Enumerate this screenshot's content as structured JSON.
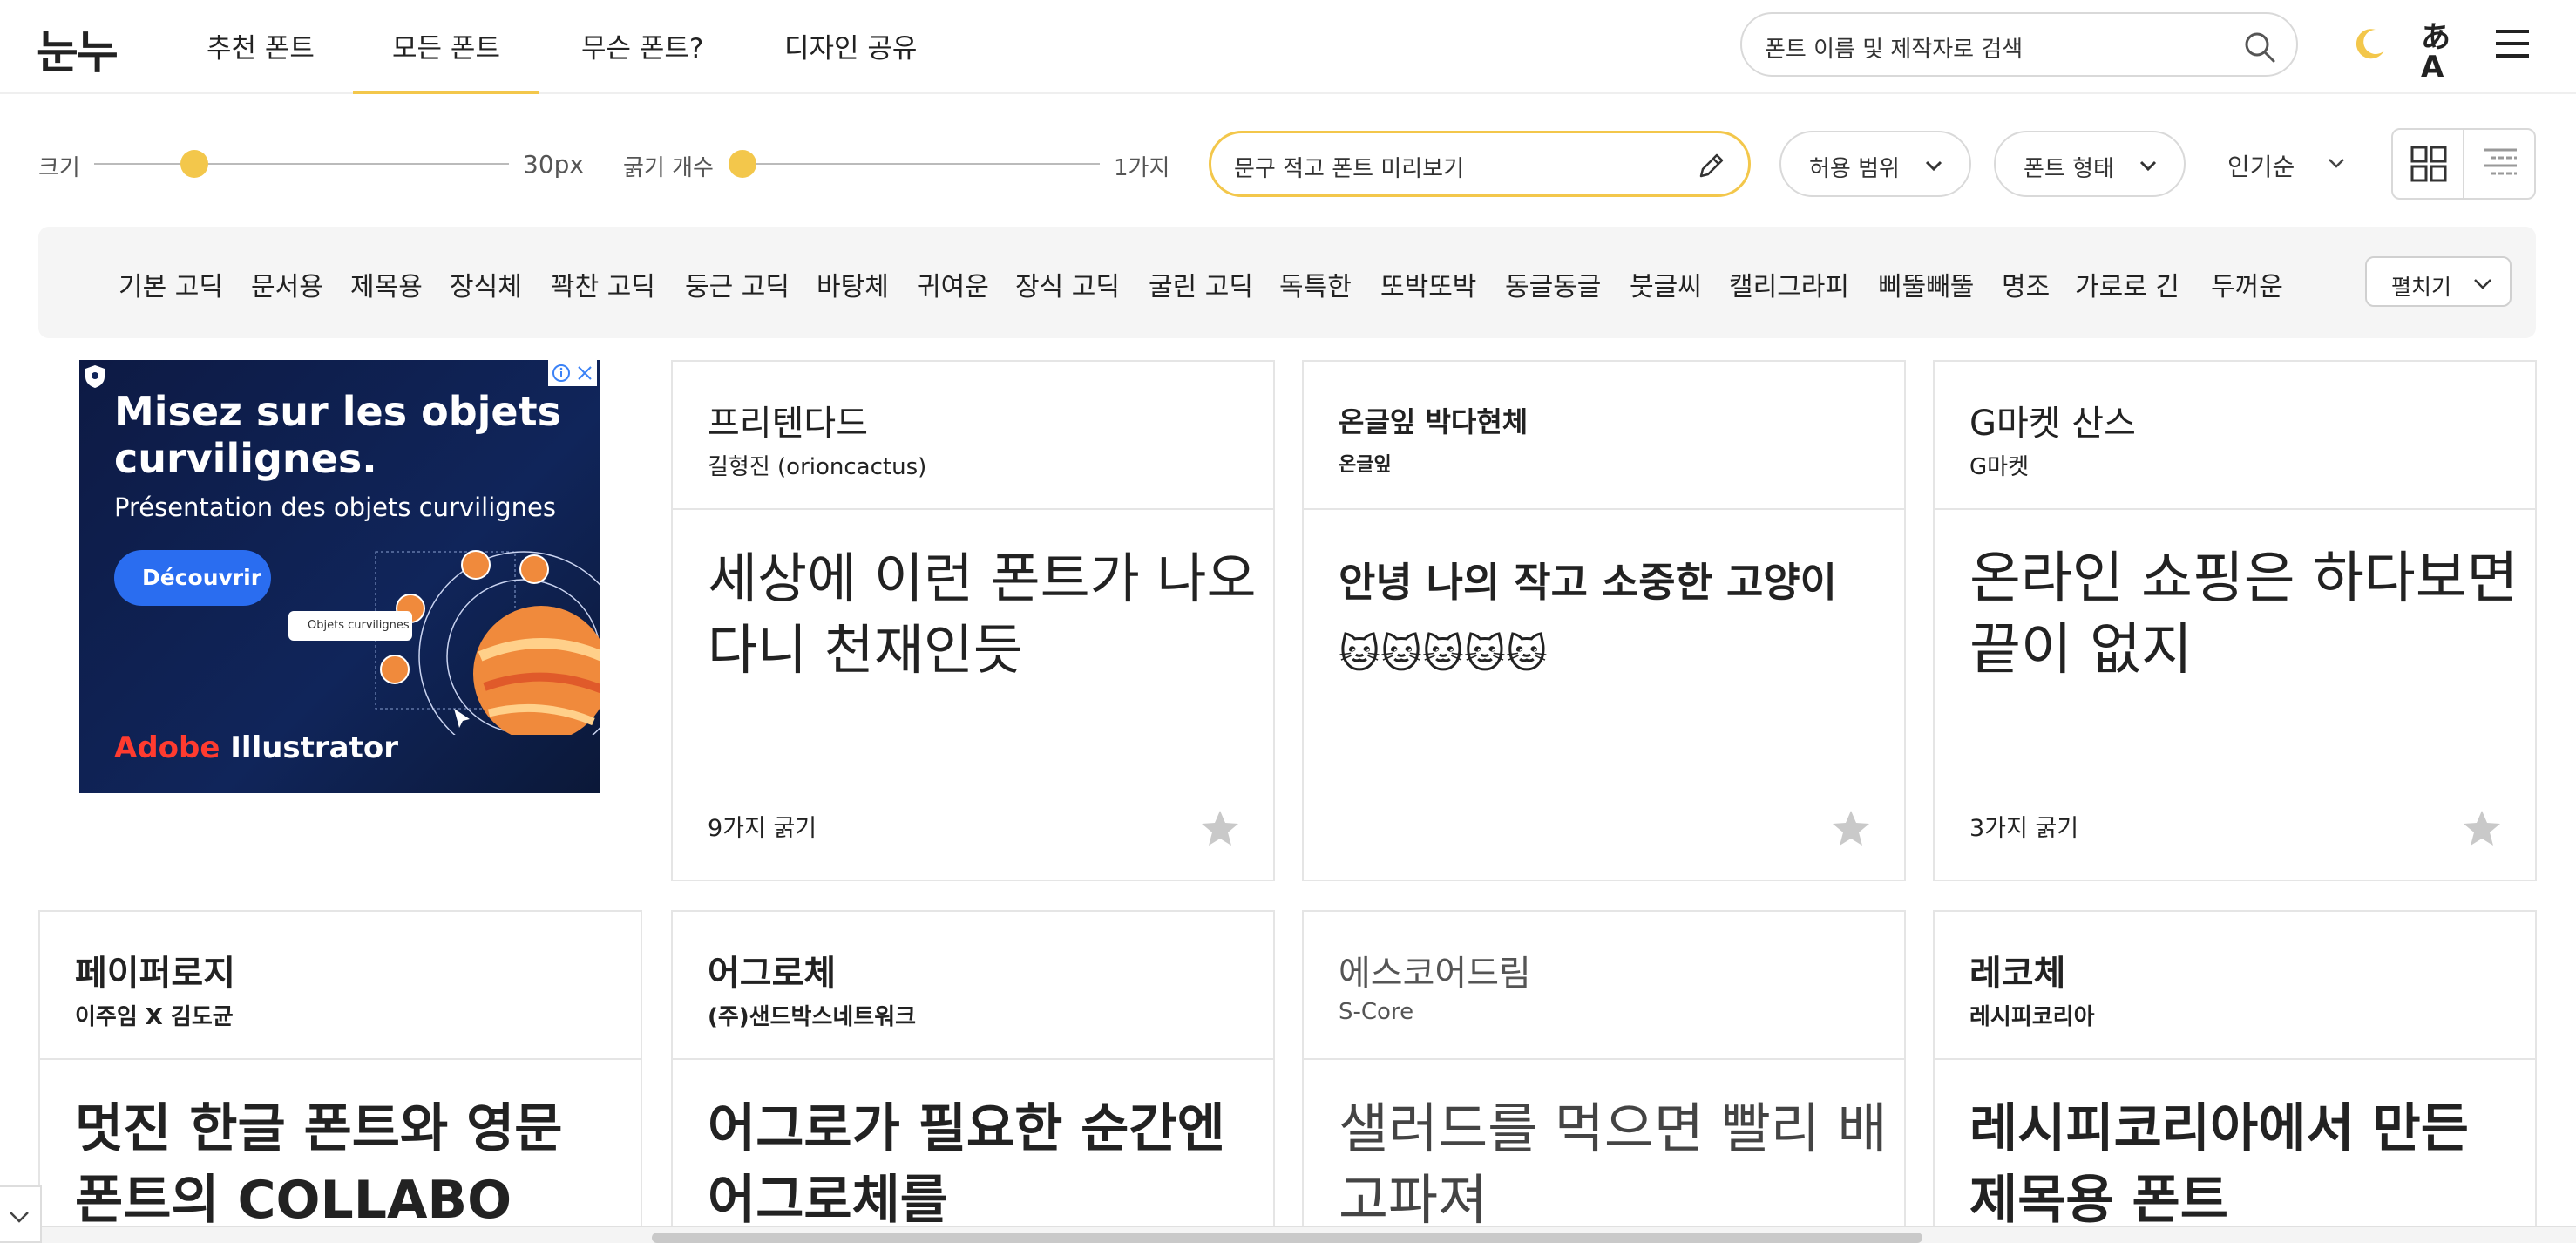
{
  "header": {
    "logo": "눈누",
    "nav": [
      {
        "label": "추천 폰트",
        "active": false
      },
      {
        "label": "모든 폰트",
        "active": true
      },
      {
        "label": "무슨 폰트?",
        "active": false
      },
      {
        "label": "디자인 공유",
        "active": false
      }
    ],
    "search_placeholder": "폰트 이름 및 제작자로 검색",
    "lang_glyph": "あA"
  },
  "controls": {
    "size_label": "크기",
    "size_value": "30px",
    "weight_label": "굵기 개수",
    "weight_value": "1가지",
    "preview_placeholder": "문구 적고 폰트 미리보기",
    "license_filter": "허용 범위",
    "type_filter": "폰트 형태",
    "sort": "인기순"
  },
  "categories": [
    "기본 고딕",
    "문서용",
    "제목용",
    "장식체",
    "꽉찬 고딕",
    "둥근 고딕",
    "바탕체",
    "귀여운",
    "장식 고딕",
    "굴린 고딕",
    "독특한",
    "또박또박",
    "동글동글",
    "붓글씨",
    "캘리그라피",
    "삐뚤빼뚤",
    "명조",
    "가로로 긴",
    "두꺼운"
  ],
  "expand_label": "펼치기",
  "ad": {
    "headline": "Misez sur les objets curvilignes.",
    "subtitle": "Présentation des objets curvilignes",
    "cta": "Découvrir",
    "chip": "Objets curvilignes",
    "brand_a": "Adobe",
    "brand_b": " Illustrator"
  },
  "cards": [
    {
      "name": "프리텐다드",
      "author": "길형진 (orioncactus)",
      "sample": "세상에 이런 폰트가 나오다니 천재인듯",
      "weights": "9가지 굵기"
    },
    {
      "name": "온글잎 박다현체",
      "author": "온글잎",
      "sample": "안녕 나의 작고 소중한 고양이 🐱🐱🐱🐱🐱",
      "weights": ""
    },
    {
      "name": "G마켓 산스",
      "author": "G마켓",
      "sample": "온라인 쇼핑은 하다보면 끝이 없지",
      "weights": "3가지 굵기"
    },
    {
      "name": "페이퍼로지",
      "author": "이주임 X 김도균",
      "sample": "멋진 한글 폰트와 영문 폰트의 COLLABO",
      "weights": ""
    },
    {
      "name": "어그로체",
      "author": "(주)샌드박스네트워크",
      "sample": "어그로가 필요한 순간엔 어그로체를",
      "weights": ""
    },
    {
      "name": "에스코어드림",
      "author": "S-Core",
      "sample": "샐러드를 먹으면 빨리 배고파져",
      "weights": ""
    },
    {
      "name": "레코체",
      "author": "레시피코리아",
      "sample": "레시피코리아에서 만든 제목용 폰트",
      "weights": ""
    }
  ],
  "colors": {
    "accent": "#f3c74b",
    "border": "#e5e5e5",
    "category_bg": "#f5f5f5"
  }
}
